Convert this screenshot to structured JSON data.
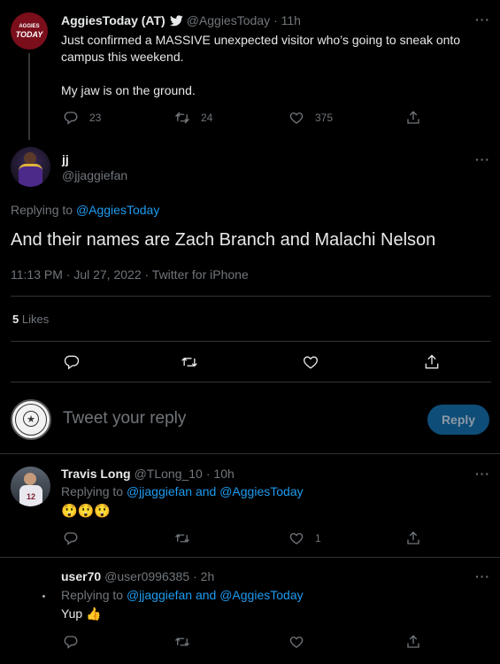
{
  "tweet1": {
    "avatar_text_top": "AGGIES",
    "avatar_text_bottom": "TODAY",
    "name": "AggiesToday (AT)",
    "handle": "@AggiesToday",
    "time": "· 11h",
    "line1": "Just confirmed a MASSIVE unexpected visitor who’s going to sneak onto",
    "line2": "campus this weekend.",
    "line3": "My jaw is on the ground.",
    "replies": "23",
    "retweets": "24",
    "likes": "375"
  },
  "main": {
    "name": "jj",
    "handle": "@jjaggiefan",
    "replying_prefix": "Replying to",
    "replying_to": "@AggiesToday",
    "text": "And their names are Zach Branch and Malachi Nelson",
    "meta": "11:13 PM · Jul 27, 2022 · Twitter for iPhone",
    "likes_count": "5",
    "likes_label": "Likes"
  },
  "compose": {
    "placeholder": "Tweet your reply",
    "reply_button": "Reply"
  },
  "reply1": {
    "name": "Travis Long",
    "handle": "@TLong_10",
    "time": "· 10h",
    "replying_prefix": "Replying to",
    "replying_to": "@jjaggiefan and @AggiesToday",
    "text": "😲😲😲",
    "likes": "1"
  },
  "reply2": {
    "name": "user70",
    "handle": "@user0996385",
    "time": "· 2h",
    "replying_prefix": "Replying to",
    "replying_to": "@jjaggiefan and @AggiesToday",
    "text": "Yup 👍"
  },
  "colors": {
    "background": "#000000",
    "accent": "#1d9bf0",
    "muted": "#71767b",
    "divider": "#2f3336",
    "reply_button_bg": "#0e4d78"
  }
}
